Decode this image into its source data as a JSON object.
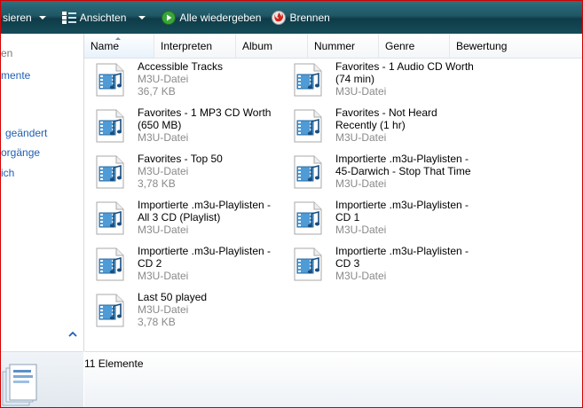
{
  "toolbar": {
    "organize_label": "sieren",
    "views_label": "Ansichten",
    "playall_label": "Alle wiedergeben",
    "burn_label": "Brennen"
  },
  "nav": {
    "items": [
      {
        "label": "en"
      },
      {
        "label": "mente"
      },
      {
        "label": "geändert"
      },
      {
        "label": "orgänge"
      },
      {
        "label": "ich"
      }
    ]
  },
  "columns": [
    "Name",
    "Interpreten",
    "Album",
    "Nummer",
    "Genre",
    "Bewertung"
  ],
  "files": [
    {
      "name": "Accessible Tracks",
      "type": "M3U-Datei",
      "size": "36,7 KB"
    },
    {
      "name": "Favorites - 1 Audio CD Worth\n(74 min)",
      "type": "M3U-Datei",
      "size": ""
    },
    {
      "name": "Favorites - 1 MP3 CD Worth\n(650 MB)",
      "type": "M3U-Datei",
      "size": ""
    },
    {
      "name": "Favorites - Not Heard\nRecently (1 hr)",
      "type": "M3U-Datei",
      "size": ""
    },
    {
      "name": "Favorites - Top 50",
      "type": "M3U-Datei",
      "size": "3,78 KB"
    },
    {
      "name": "Importierte .m3u-Playlisten -\n45-Darwich - Stop That Time",
      "type": "M3U-Datei",
      "size": ""
    },
    {
      "name": "Importierte .m3u-Playlisten -\nAll 3 CD (Playlist)",
      "type": "M3U-Datei",
      "size": ""
    },
    {
      "name": "Importierte .m3u-Playlisten -\nCD 1",
      "type": "M3U-Datei",
      "size": ""
    },
    {
      "name": "Importierte .m3u-Playlisten -\nCD 2",
      "type": "M3U-Datei",
      "size": ""
    },
    {
      "name": "Importierte .m3u-Playlisten -\nCD 3",
      "type": "M3U-Datei",
      "size": ""
    },
    {
      "name": "Last 50 played",
      "type": "M3U-Datei",
      "size": "3,78 KB"
    }
  ],
  "status": {
    "count": "11 Elemente"
  },
  "colors": {
    "toolbar": "#1f5664",
    "link": "#1f5fb4",
    "frame": "#d40000"
  }
}
